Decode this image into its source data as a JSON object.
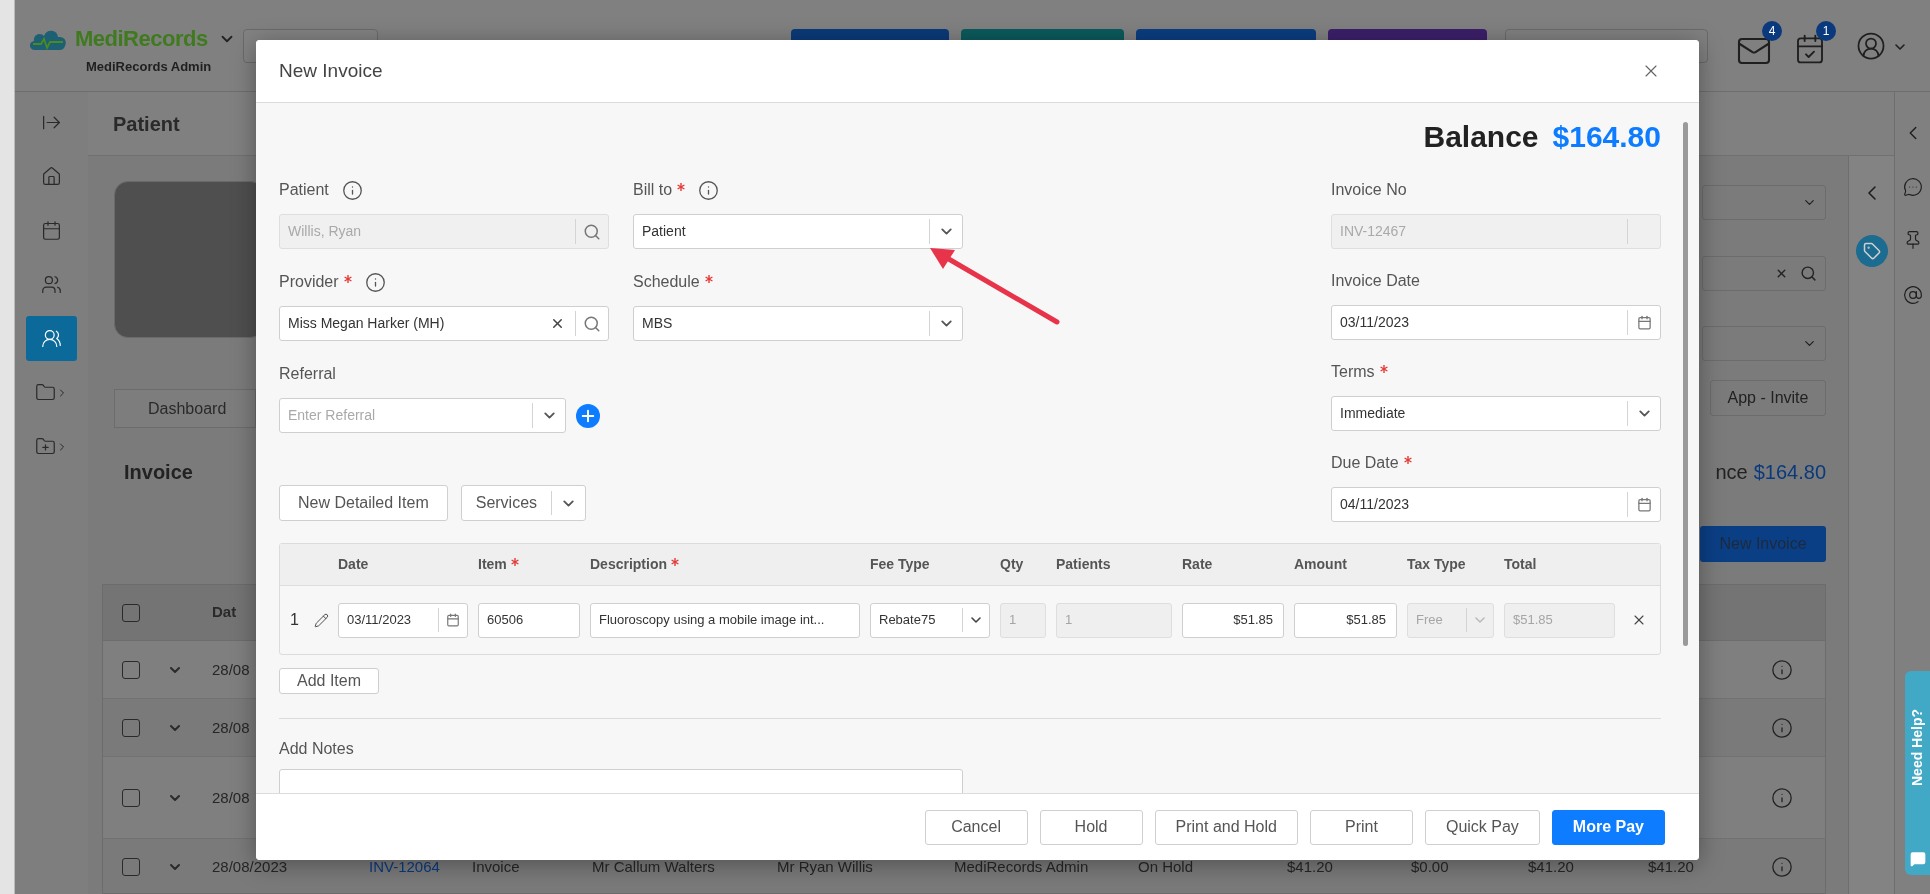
{
  "header": {
    "brand": "MediRecords",
    "org": "MediRecords Admin",
    "badges": [
      {
        "kind": "mail",
        "count": "4"
      },
      {
        "kind": "tasks",
        "count": "1"
      }
    ]
  },
  "sidebar": {
    "items": [
      {
        "kind": "expand",
        "selected": false
      },
      {
        "kind": "home",
        "selected": false
      },
      {
        "kind": "calendar",
        "selected": false
      },
      {
        "kind": "contacts",
        "selected": false
      },
      {
        "kind": "patients",
        "selected": true
      },
      {
        "kind": "folder",
        "selected": false
      },
      {
        "kind": "folder-add",
        "selected": false
      }
    ]
  },
  "page": {
    "title": "Patient",
    "dashboard_tab": "Dashboard",
    "section_title": "Invoice",
    "invite_button": "App - Invite",
    "balance_label": "nce",
    "balance": "$164.80",
    "new_invoice_button": "New Invoice"
  },
  "invoice_list": {
    "header": {
      "checked": false,
      "column_1": "Dat"
    },
    "rows": [
      {
        "checked": false,
        "expanded": false,
        "cells": [
          {
            "kind": "text",
            "text": "28/08"
          }
        ]
      },
      {
        "checked": false,
        "expanded": false,
        "cells": [
          {
            "kind": "text",
            "text": "28/08"
          }
        ]
      },
      {
        "checked": false,
        "expanded": false,
        "cells": [
          {
            "kind": "text",
            "text": "28/08"
          }
        ]
      },
      {
        "checked": false,
        "expanded": false,
        "cells": [
          {
            "kind": "text",
            "text": "28/08/2023"
          },
          {
            "kind": "link",
            "text": "INV-12064"
          },
          {
            "kind": "text",
            "text": "Invoice"
          },
          {
            "kind": "text",
            "text": "Mr Callum Walters"
          },
          {
            "kind": "text",
            "text": "Mr Ryan Willis"
          },
          {
            "kind": "text",
            "text": "MediRecords Admin"
          },
          {
            "kind": "text",
            "text": "On Hold"
          },
          {
            "kind": "text",
            "text": "$41.20"
          },
          {
            "kind": "text",
            "text": "$0.00"
          },
          {
            "kind": "text",
            "text": "$41.20"
          },
          {
            "kind": "text",
            "text": "$41.20"
          }
        ]
      }
    ]
  },
  "help_tab": {
    "label": "Need Help?"
  },
  "modal": {
    "title": "New Invoice",
    "balance_label": "Balance",
    "balance": "$164.80",
    "left_fields": [
      {
        "label": "Patient",
        "kind": "search",
        "required": false,
        "info": true,
        "value": "Willis, Ryan",
        "disabled": true,
        "clearable": false,
        "add_button": false
      },
      {
        "label": "Bill to",
        "kind": "select",
        "required": true,
        "info": true,
        "value": "Patient",
        "disabled": false,
        "clearable": false,
        "add_button": false
      },
      {
        "label": "Provider",
        "kind": "search",
        "required": true,
        "info": true,
        "value": "Miss Megan Harker (MH)",
        "disabled": false,
        "clearable": true,
        "add_button": false
      },
      {
        "label": "Schedule",
        "kind": "select",
        "required": true,
        "info": false,
        "value": "MBS",
        "disabled": false,
        "clearable": false,
        "add_button": false
      },
      {
        "label": "Referral",
        "kind": "select",
        "required": false,
        "info": false,
        "placeholder": "Enter Referral",
        "disabled": false,
        "clearable": false,
        "add_button": true
      }
    ],
    "right_fields": [
      {
        "label": "Invoice No",
        "kind": "text",
        "required": false,
        "info": false,
        "value": "INV-12467",
        "disabled": true
      },
      {
        "label": "Invoice Date",
        "kind": "date",
        "required": false,
        "info": false,
        "value": "03/11/2023",
        "disabled": false
      },
      {
        "label": "Terms",
        "kind": "select",
        "required": true,
        "info": false,
        "value": "Immediate",
        "disabled": false
      },
      {
        "label": "Due Date",
        "kind": "date",
        "required": true,
        "info": false,
        "value": "04/11/2023",
        "disabled": false
      }
    ],
    "item_actions": [
      {
        "label": "New Detailed Item",
        "kind": "button"
      },
      {
        "label": "Services",
        "kind": "split"
      }
    ],
    "items_table": {
      "columns": [
        {
          "label": "Date",
          "required": false
        },
        {
          "label": "Item",
          "required": true
        },
        {
          "label": "Description",
          "required": true
        },
        {
          "label": "Fee Type",
          "required": false
        },
        {
          "label": "Qty",
          "required": false
        },
        {
          "label": "Patients",
          "required": false
        },
        {
          "label": "Rate",
          "required": false
        },
        {
          "label": "Amount",
          "required": false
        },
        {
          "label": "Tax Type",
          "required": false
        },
        {
          "label": "Total",
          "required": false
        }
      ],
      "rows": [
        {
          "number": "1",
          "cells": [
            {
              "kind": "date",
              "value": "03/11/2023",
              "disabled": false
            },
            {
              "kind": "text",
              "value": "60506",
              "disabled": false
            },
            {
              "kind": "text",
              "value": "Fluoroscopy using a mobile image int...",
              "disabled": false
            },
            {
              "kind": "select",
              "value": "Rebate75",
              "disabled": false
            },
            {
              "kind": "text",
              "value": "1",
              "disabled": true
            },
            {
              "kind": "text",
              "value": "1",
              "disabled": true
            },
            {
              "kind": "money",
              "value": "$51.85",
              "disabled": false
            },
            {
              "kind": "money",
              "value": "$51.85",
              "disabled": false
            },
            {
              "kind": "select",
              "value": "Free",
              "disabled": true
            },
            {
              "kind": "text",
              "value": "$51.85",
              "disabled": true
            }
          ]
        }
      ]
    },
    "add_item": "Add Item",
    "notes_label": "Add Notes",
    "footer_buttons": [
      {
        "label": "Cancel",
        "primary": false
      },
      {
        "label": "Hold",
        "primary": false
      },
      {
        "label": "Print and Hold",
        "primary": false
      },
      {
        "label": "Print",
        "primary": false
      },
      {
        "label": "Quick Pay",
        "primary": false
      },
      {
        "label": "More Pay",
        "primary": true
      }
    ]
  }
}
